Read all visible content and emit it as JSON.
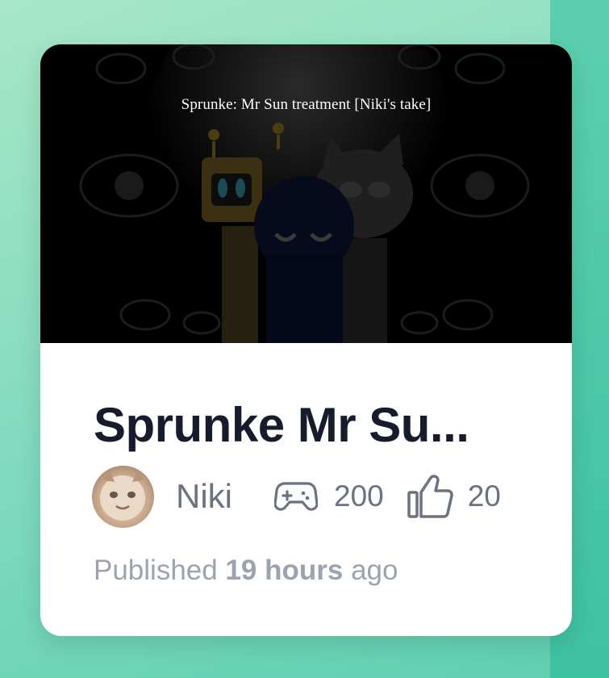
{
  "card": {
    "thumbnail_caption": "Sprunke: Mr Sun treatment [Niki's take]",
    "title": "Sprunke Mr Su...",
    "author": "Niki",
    "plays": "200",
    "likes": "20",
    "published": {
      "prefix": "Published",
      "amount": "19 hours",
      "suffix": "ago"
    }
  },
  "icons": {
    "plays": "gamepad-icon",
    "likes": "thumbs-up-icon"
  },
  "colors": {
    "background": "#8fdcc2",
    "title": "#161c2b",
    "meta": "#6b7280",
    "muted": "#9ca3af"
  }
}
